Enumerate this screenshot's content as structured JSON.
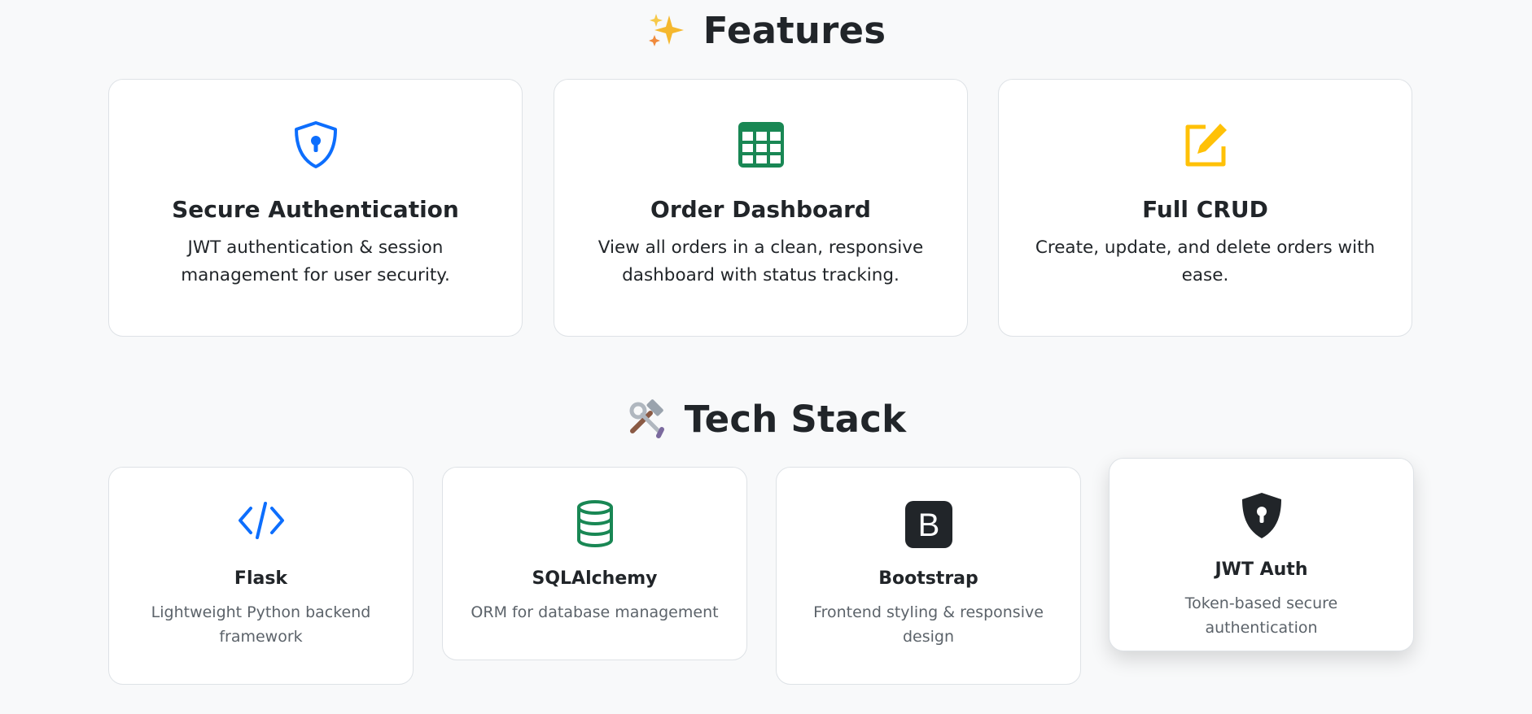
{
  "features": {
    "title": "Features",
    "title_emoji": "sparkles-icon",
    "cards": [
      {
        "icon": "shield-lock-icon",
        "color": "#0d6efd",
        "title": "Secure Authentication",
        "text": "JWT authentication & session management for user security."
      },
      {
        "icon": "table-icon",
        "color": "#198754",
        "title": "Order Dashboard",
        "text": "View all orders in a clean, responsive dashboard with status tracking."
      },
      {
        "icon": "pencil-square-icon",
        "color": "#ffc107",
        "title": "Full CRUD",
        "text": "Create, update, and delete orders with ease."
      }
    ]
  },
  "tech_stack": {
    "title": "Tech Stack",
    "title_emoji": "hammer-wrench-icon",
    "cards": [
      {
        "icon": "code-slash-icon",
        "color": "#0d6efd",
        "title": "Flask",
        "text": "Lightweight Python backend framework"
      },
      {
        "icon": "database-icon",
        "color": "#198754",
        "title": "SQLAlchemy",
        "text": "ORM for database management"
      },
      {
        "icon": "bootstrap-icon",
        "color": "#212529",
        "title": "Bootstrap",
        "text": "Frontend styling & responsive design"
      },
      {
        "icon": "shield-lock-fill-icon",
        "color": "#212529",
        "title": "JWT Auth",
        "text": "Token-based secure authentication"
      }
    ]
  }
}
